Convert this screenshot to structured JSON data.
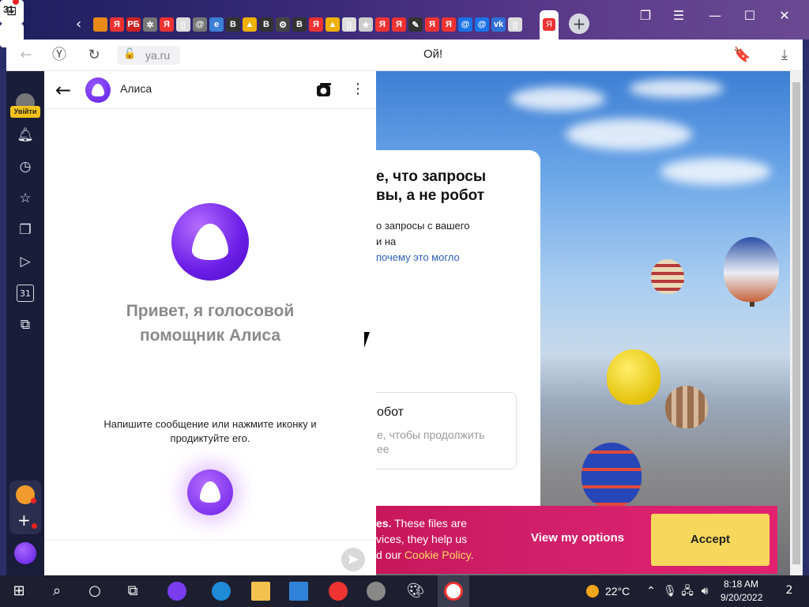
{
  "tabbar": {
    "home_label": "31",
    "favicons": [
      {
        "letter": "",
        "color": "#e98a19"
      },
      {
        "letter": "Я",
        "color": "#e33"
      },
      {
        "letter": "PБ",
        "color": "#c22"
      },
      {
        "letter": "✲",
        "color": "#777"
      },
      {
        "letter": "Я",
        "color": "#e33"
      },
      {
        "letter": "▯",
        "color": "#ddd"
      },
      {
        "letter": "@",
        "color": "#777"
      },
      {
        "letter": "e",
        "color": "#3b7fd6"
      },
      {
        "letter": "B",
        "color": "#333"
      },
      {
        "letter": "▲",
        "color": "#f0b000"
      },
      {
        "letter": "B",
        "color": "#333"
      },
      {
        "letter": "⚙",
        "color": "#444"
      },
      {
        "letter": "B",
        "color": "#333"
      },
      {
        "letter": "Я",
        "color": "#e33"
      },
      {
        "letter": "▲",
        "color": "#f0b000"
      },
      {
        "letter": "▯",
        "color": "#ddd"
      },
      {
        "letter": "★",
        "color": "#ccc"
      },
      {
        "letter": "Я",
        "color": "#e33"
      },
      {
        "letter": "Я",
        "color": "#e33"
      },
      {
        "letter": "✎",
        "color": "#333"
      },
      {
        "letter": "Я",
        "color": "#e33"
      },
      {
        "letter": "Я",
        "color": "#e33"
      },
      {
        "letter": "@",
        "color": "#1a73e8"
      },
      {
        "letter": "@",
        "color": "#1a73e8"
      },
      {
        "letter": "vk",
        "color": "#2f6fd6"
      },
      {
        "letter": "▯",
        "color": "#ddd"
      }
    ],
    "active_tab_letter": "Я",
    "add_tab": "+"
  },
  "address": {
    "url": "ya.ru",
    "title": "Ой!"
  },
  "sidebar": {
    "login_label": "Увійти",
    "calendar_label": "31"
  },
  "alice": {
    "name": "Алиса",
    "greeting": "Привет, я голосовой помощник Алиса",
    "hint": "Напишите сообщение или нажмите иконку и продиктуйте его."
  },
  "page": {
    "captcha_title": "е, что запросы\nвы, а не робот",
    "captcha_desc_line1": "о запросы с вашего",
    "captcha_desc_line2": "и на",
    "captcha_link": "почему это могло",
    "robot_title": "обот",
    "robot_sub": "е, чтобы продолжить\nее",
    "cookie_text_pre": "es.",
    "cookie_text_mid": " These files are\nvices, they help us\nd our ",
    "cookie_link": "Cookie Policy",
    "cookie_text_end": ".",
    "view_options": "View my options",
    "accept": "Accept"
  },
  "taskbar": {
    "temperature": "22°C",
    "time": "8:18 AM",
    "date": "9/20/2022",
    "notification_count": "2"
  }
}
